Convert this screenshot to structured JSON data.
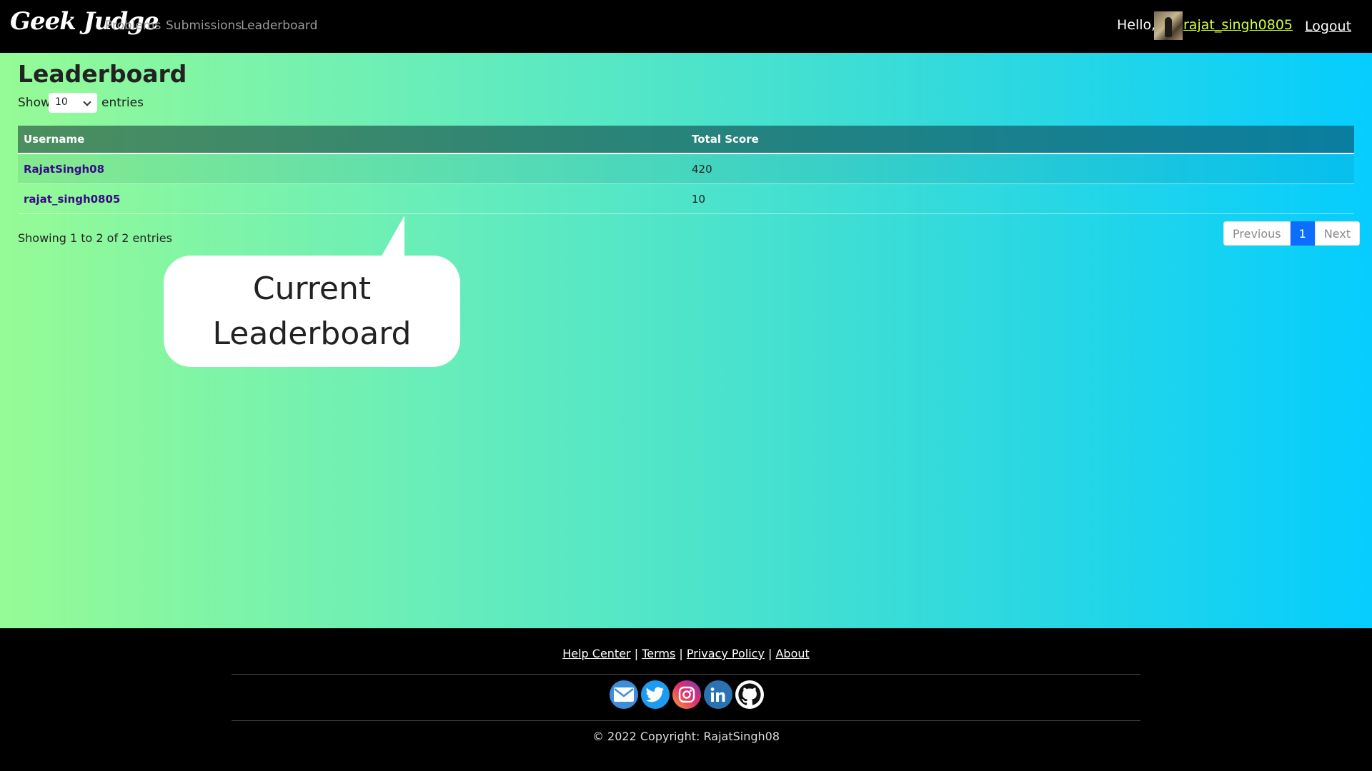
{
  "nav": {
    "brand": "Geek Judge",
    "links": [
      "Problems",
      "Submissions",
      "Leaderboard"
    ],
    "greeting": "Hello,",
    "username": "rajat_singh0805",
    "logout": "Logout"
  },
  "page": {
    "title": "Leaderboard",
    "show_label": "Show",
    "entries_select": "10",
    "entries_label": "entries",
    "columns": [
      "Username",
      "Total Score"
    ],
    "rows": [
      {
        "username": "RajatSingh08",
        "score": "420"
      },
      {
        "username": "rajat_singh0805",
        "score": "10"
      }
    ],
    "info": "Showing 1 to 2 of 2 entries",
    "pagination": {
      "previous": "Previous",
      "page": "1",
      "next": "Next"
    }
  },
  "callout": {
    "line1": "Current",
    "line2": "Leaderboard"
  },
  "footer": {
    "links": [
      "Help Center",
      "Terms",
      "Privacy Policy",
      "About"
    ],
    "socials": [
      "email-icon",
      "twitter-icon",
      "instagram-icon",
      "linkedin-icon",
      "github-icon"
    ],
    "copyright": "© 2022 Copyright: RajatSingh08"
  },
  "colors": {
    "accent_link": "#d3ff36",
    "pagination_active": "#0d6efd",
    "row_link": "#3a0a87"
  }
}
